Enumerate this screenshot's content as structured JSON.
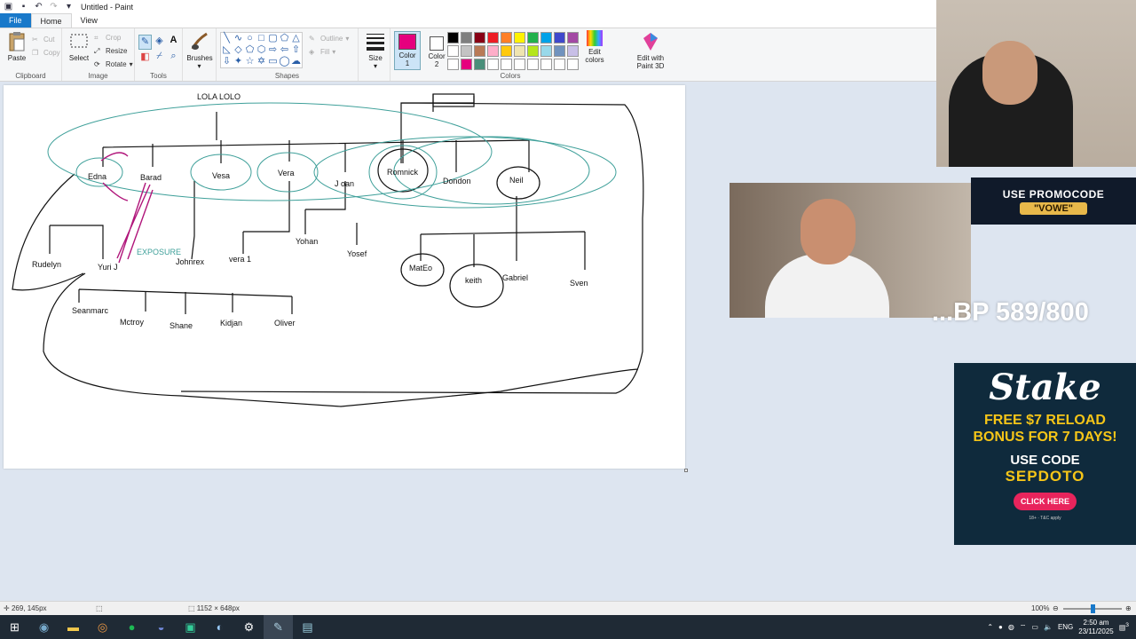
{
  "window": {
    "title": "Untitled - Paint"
  },
  "tabs": [
    "File",
    "Home",
    "View"
  ],
  "ribbon": {
    "clipboard": {
      "label": "Clipboard",
      "paste": "Paste",
      "cut": "Cut",
      "copy": "Copy"
    },
    "image": {
      "label": "Image",
      "select": "Select",
      "crop": "Crop",
      "resize": "Resize",
      "rotate": "Rotate"
    },
    "tools": {
      "label": "Tools"
    },
    "brushes": {
      "label": "Brushes"
    },
    "shapes": {
      "label": "Shapes",
      "outline": "Outline",
      "fill": "Fill"
    },
    "size": {
      "label": "Size"
    },
    "colors": {
      "label": "Colors",
      "color1": "Color\n1",
      "color1_a": "Color",
      "color1_b": "1",
      "color2_a": "Color",
      "color2_b": "2",
      "color1_value": "#e6007e",
      "color2_value": "#ffffff",
      "edit_colors_a": "Edit",
      "edit_colors_b": "colors",
      "paint3d_a": "Edit with",
      "paint3d_b": "Paint 3D",
      "palette": [
        "#000000",
        "#7f7f7f",
        "#880015",
        "#ed1c24",
        "#ff7f27",
        "#fff200",
        "#22b14c",
        "#00a2e8",
        "#3f48cc",
        "#a349a4",
        "#ffffff",
        "#c3c3c3",
        "#b97a57",
        "#ffaec9",
        "#ffc90e",
        "#efe4b0",
        "#b5e61d",
        "#99d9ea",
        "#7092be",
        "#c8bfe7",
        "#ffffff",
        "#e6007e",
        "#4a8f7a",
        "#ffffff",
        "#ffffff",
        "#ffffff",
        "#ffffff",
        "#ffffff",
        "#ffffff",
        "#ffffff"
      ]
    }
  },
  "canvas_labels": {
    "top": "LOLA LOLO",
    "row1": [
      "Edna",
      "Barad",
      "Vesa",
      "Vera",
      "J oan",
      "Romnick",
      "Dondon",
      "Neil"
    ],
    "row2": [
      "Rudelyn",
      "Yuri J",
      "EXPOSURE",
      "Johnrex",
      "vera 1",
      "Yohan",
      "Yosef",
      "MatEo",
      "keith",
      "Gabriel",
      "Sven"
    ],
    "row3": [
      "Seanmarc",
      "Mctroy",
      "Shane",
      "Kidjan",
      "Oliver"
    ]
  },
  "statusbar": {
    "position": "269, 145px",
    "canvas_size": "1152 × 648px",
    "zoom": "100%"
  },
  "taskbar": {
    "lang": "ENG",
    "time": "2:50 am",
    "date": "23/11/2025",
    "notif": "3"
  },
  "overlays": {
    "promo_line1": "USE PROMOCODE",
    "promo_line2": "\"VOWE\"",
    "score_text": "...BP 589/800",
    "stake_logo": "Stake",
    "stake_offer1": "FREE $7 RELOAD",
    "stake_offer2": "BONUS FOR 7 DAYS!",
    "stake_code1": "USE CODE",
    "stake_code2": "SEPDOTO",
    "stake_button": "CLICK HERE",
    "stake_fine": "18+ · T&C apply"
  }
}
